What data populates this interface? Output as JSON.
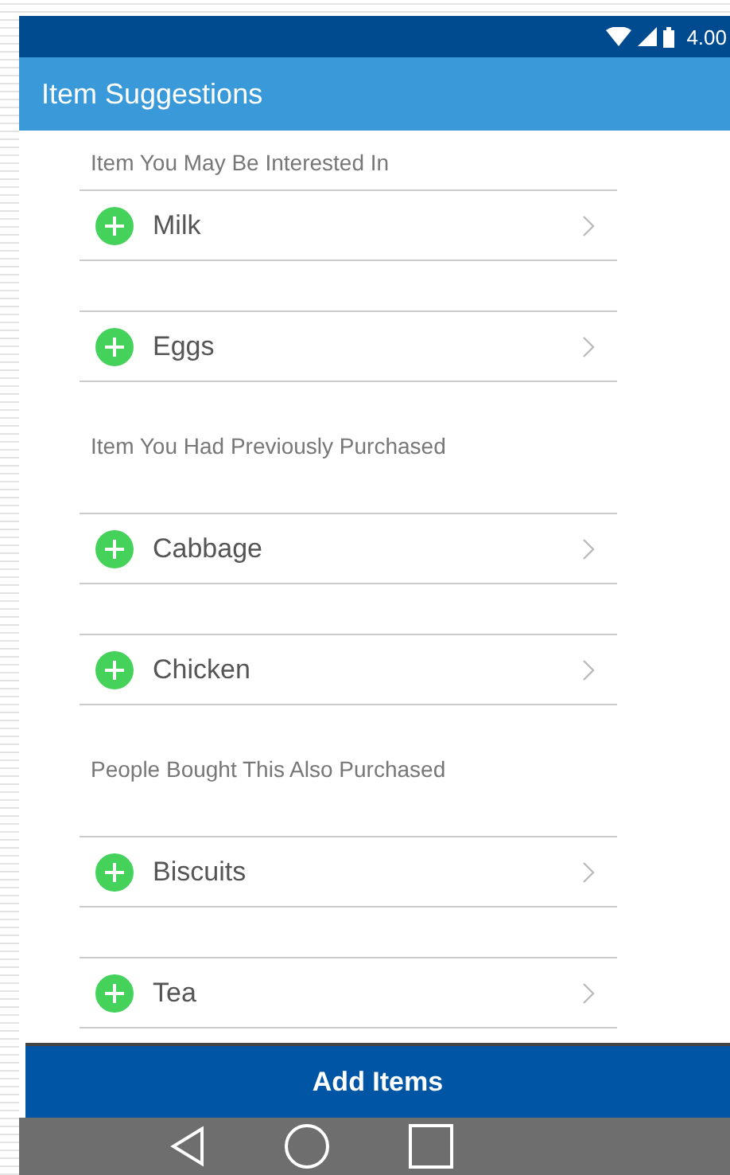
{
  "status_bar": {
    "time": "4.00"
  },
  "header": {
    "title": "Item Suggestions"
  },
  "sections": [
    {
      "title": "Item You May Be Interested In",
      "items": [
        {
          "label": "Milk"
        },
        {
          "label": "Eggs"
        }
      ]
    },
    {
      "title": "Item You Had Previously Purchased",
      "items": [
        {
          "label": "Cabbage"
        },
        {
          "label": "Chicken"
        }
      ]
    },
    {
      "title": "People Bought This Also Purchased",
      "items": [
        {
          "label": "Biscuits"
        },
        {
          "label": "Tea"
        }
      ]
    }
  ],
  "action_button": {
    "label": "Add Items"
  }
}
